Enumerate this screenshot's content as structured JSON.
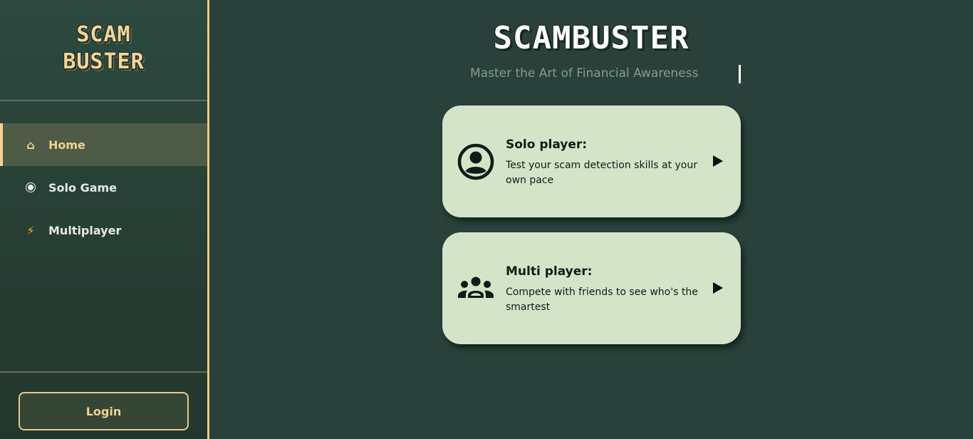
{
  "sidebar": {
    "logo_line1": "SCAM",
    "logo_line2": "BUSTER",
    "items": [
      {
        "label": "Home",
        "icon": "home-icon",
        "active": true
      },
      {
        "label": "Solo Game",
        "icon": "radio-dot-icon",
        "active": false
      },
      {
        "label": "Multiplayer",
        "icon": "lightning-bolt-icon",
        "active": false
      }
    ],
    "login_label": "Login"
  },
  "main": {
    "title": "SCAMBUSTER",
    "subtitle": "Master the Art of Financial Awareness",
    "cards": [
      {
        "title": "Solo player:",
        "description": "Test your scam detection skills at your own pace",
        "icon": "user-circle-icon"
      },
      {
        "title": "Multi player:",
        "description": "Compete with friends to see who's the smartest",
        "icon": "group-icon"
      }
    ]
  },
  "colors": {
    "background": "#29413a",
    "accent": "#f1d38e",
    "card_background": "#d3e4c9",
    "subtitle": "#879c85"
  }
}
